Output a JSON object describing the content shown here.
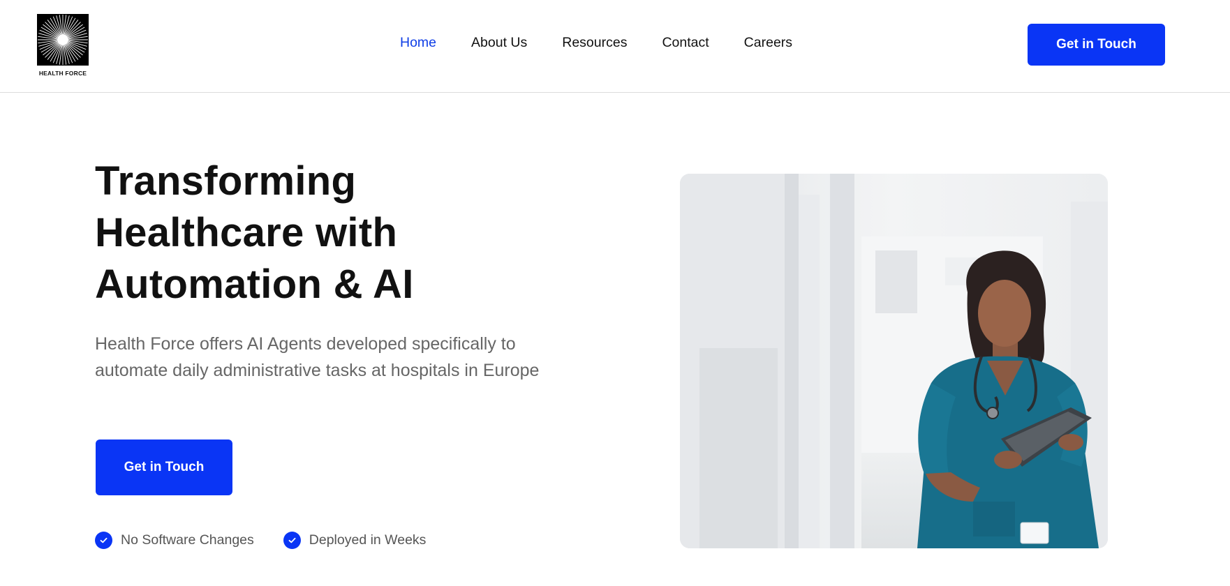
{
  "brand": {
    "name": "HEALTH FORCE",
    "accent_color": "#0a35f5",
    "logo_icon": "sunburst-logo-icon"
  },
  "nav": {
    "items": [
      {
        "label": "Home",
        "active": true
      },
      {
        "label": "About Us",
        "active": false
      },
      {
        "label": "Resources",
        "active": false
      },
      {
        "label": "Contact",
        "active": false
      },
      {
        "label": "Careers",
        "active": false
      }
    ],
    "cta_label": "Get in Touch"
  },
  "hero": {
    "title_lines": [
      "Transforming",
      "Healthcare with",
      "Automation & AI"
    ],
    "description": "Health Force offers AI Agents developed specifically to automate daily administrative tasks at hospitals in Europe",
    "cta_label": "Get in Touch",
    "features": [
      {
        "label": "No Software Changes",
        "icon": "checkmark-icon"
      },
      {
        "label": "Deployed in Weeks",
        "icon": "checkmark-icon"
      }
    ]
  },
  "image": {
    "subject": "nurse-with-tablet-photo",
    "colors": {
      "scrubs": "#176e8a",
      "background": "#eef0f2"
    }
  }
}
